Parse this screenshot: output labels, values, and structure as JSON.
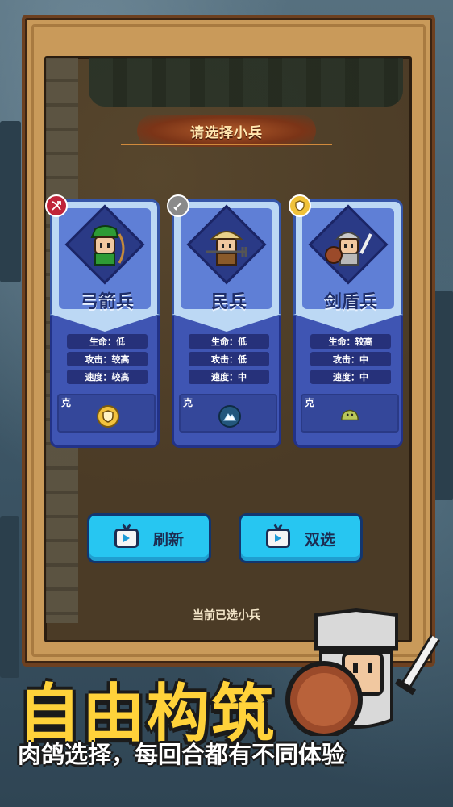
{
  "panel": {
    "title": "请选择小兵"
  },
  "cards": [
    {
      "name": "弓箭兵",
      "badge_icon": "bow-arrow-icon",
      "badge_color": "#c0243a",
      "stats": [
        "生命：低",
        "攻击：较高",
        "速度：较高"
      ],
      "counter_label": "克",
      "counter_icon": "shield-icon"
    },
    {
      "name": "民兵",
      "badge_icon": "sword-icon",
      "badge_color": "#8a8a8a",
      "stats": [
        "生命：低",
        "攻击：低",
        "速度：中"
      ],
      "counter_label": "克",
      "counter_icon": "mountain-icon"
    },
    {
      "name": "剑盾兵",
      "badge_icon": "shield-icon",
      "badge_color": "#f0c23a",
      "stats": [
        "生命：较高",
        "攻击：中",
        "速度：中"
      ],
      "counter_label": "克",
      "counter_icon": "slime-icon"
    }
  ],
  "buttons": {
    "refresh": "刷新",
    "double": "双选"
  },
  "selected_label": "当前已选小兵",
  "promo": {
    "title": "自由构筑",
    "subtitle": "肉鸽选择，每回合都有不同体验"
  },
  "colors": {
    "card_top": "#bcd8f4",
    "card_bottom": "#3f55b3",
    "button": "#27c6f1",
    "promo_title": "#ffd23a"
  }
}
